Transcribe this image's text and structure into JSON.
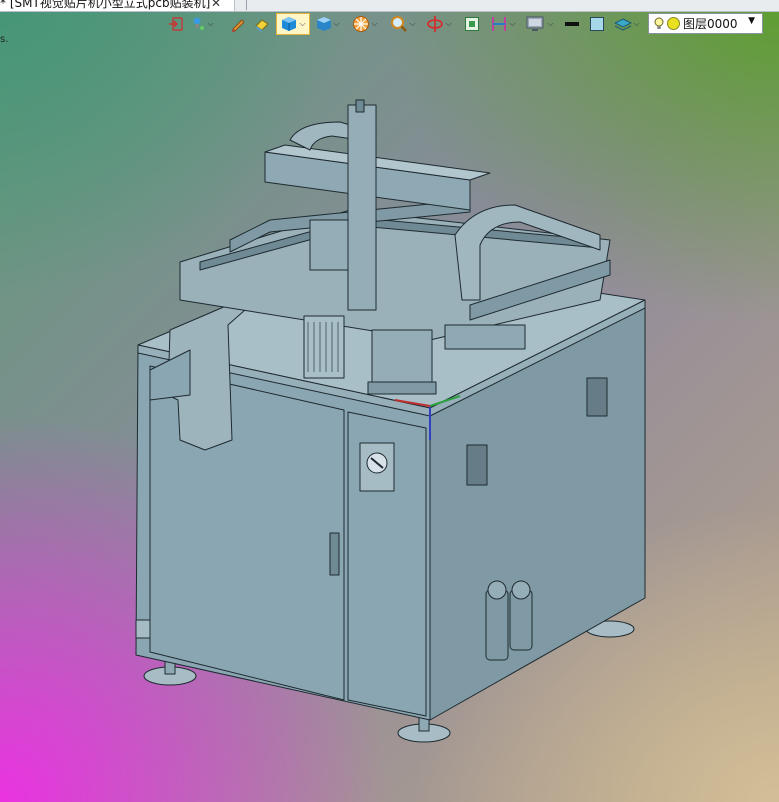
{
  "window": {
    "doc_tab_title": "* [SMT视觉贴片机小型立式pcb贴装机]",
    "close_glyph": "✕",
    "side_mark": "s."
  },
  "toolbar": {
    "buttons": [
      {
        "icon": "exit-sketch-icon"
      },
      {
        "icon": "point-light-icon",
        "has_dropdown": true
      },
      {
        "icon": "pencil-icon"
      },
      {
        "icon": "eraser-icon"
      },
      {
        "icon": "cube-view-icon",
        "has_dropdown": true,
        "active": true
      },
      {
        "icon": "cube-render-icon",
        "has_dropdown": true
      },
      {
        "icon": "wheel-icon",
        "has_dropdown": true
      },
      {
        "icon": "zoom-icon",
        "has_dropdown": true
      },
      {
        "icon": "rotate-icon",
        "has_dropdown": true
      },
      {
        "icon": "fit-icon"
      },
      {
        "icon": "section-icon",
        "has_dropdown": true
      },
      {
        "icon": "display-icon",
        "has_dropdown": true
      },
      {
        "icon": "line-color-icon"
      },
      {
        "icon": "fill-color-icon"
      },
      {
        "icon": "layers-icon",
        "has_dropdown": true
      }
    ],
    "layer_label": "图层0000"
  },
  "colors": {
    "model_face": "#8fa9b4",
    "model_edge": "#1e2a30"
  }
}
